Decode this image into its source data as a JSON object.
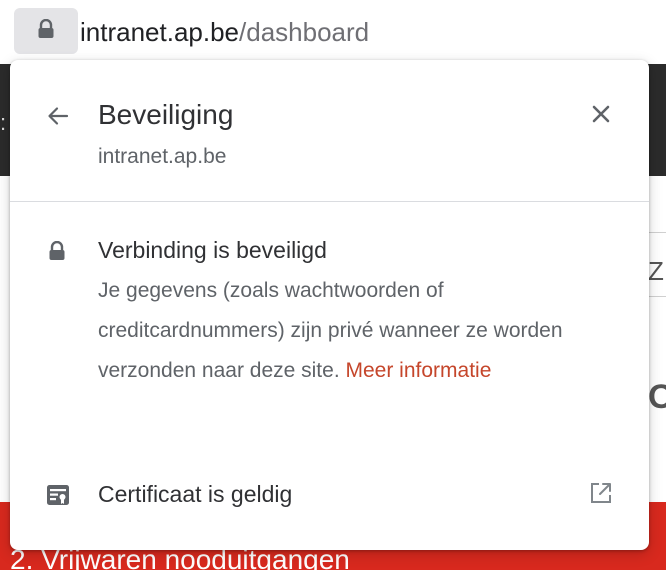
{
  "address_bar": {
    "domain": "intranet.ap.be",
    "path": "/dashboard",
    "lock_icon": "lock-icon"
  },
  "background_page": {
    "footer_text": "2. Vrijwaren nooduitgangen"
  },
  "popup": {
    "title": "Beveiliging",
    "subtitle": "intranet.ap.be",
    "back_icon": "arrow-left-icon",
    "close_icon": "close-icon",
    "connection": {
      "title": "Verbinding is beveiligd",
      "description": "Je gegevens (zoals wachtwoorden of creditcardnummers) zijn privé wanneer ze worden verzonden naar deze site.",
      "link": "Meer informatie",
      "icon": "lock-icon"
    },
    "certificate": {
      "label": "Certificaat is geldig",
      "icon": "certificate-icon",
      "external_icon": "external-link-icon"
    }
  },
  "colors": {
    "link": "#c5462b",
    "background_red": "#d8291e",
    "background_dark": "#2b2b2b"
  }
}
